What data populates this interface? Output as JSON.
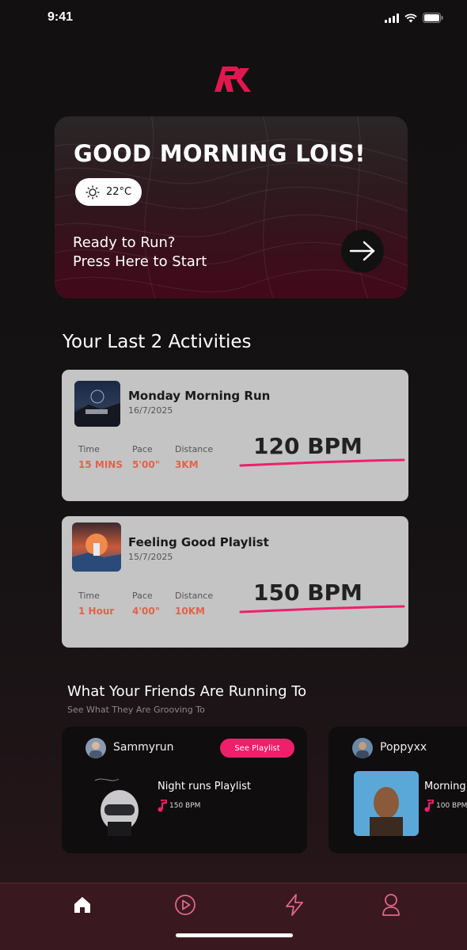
{
  "status": {
    "time": "9:41"
  },
  "hero": {
    "title": "GOOD MORNING LOIS!",
    "weather": "22°C",
    "cta_line1": "Ready to Run?",
    "cta_line2": "Press Here to Start"
  },
  "activities": {
    "title": "Your Last 2 Activities",
    "items": [
      {
        "title": "Monday Morning Run",
        "date": "16/7/2025",
        "time_label": "Time",
        "time": "15 MINS",
        "pace_label": "Pace",
        "pace": "5'00\"",
        "distance_label": "Distance",
        "distance": "3KM",
        "bpm": "120 BPM"
      },
      {
        "title": "Feeling Good Playlist",
        "date": "15/7/2025",
        "time_label": "Time",
        "time": "1 Hour",
        "pace_label": "Pace",
        "pace": "4'00\"",
        "distance_label": "Distance",
        "distance": "10KM",
        "bpm": "150 BPM"
      }
    ]
  },
  "friends": {
    "title": "What Your Friends Are Running To",
    "subtitle": "See What They Are Grooving To",
    "items": [
      {
        "name": "Sammyrun",
        "button": "See Playlist",
        "playlist": "Night runs Playlist",
        "bpm": "150 BPM"
      },
      {
        "name": "Poppyxx",
        "playlist": "Morning",
        "bpm": "100 BPM"
      }
    ]
  },
  "nav": {
    "items": [
      "home-icon",
      "play-icon",
      "lightning-icon",
      "profile-icon"
    ]
  },
  "colors": {
    "accent": "#ef1f6b",
    "stat_value": "#e2624a",
    "card": "#c4c4c4"
  }
}
